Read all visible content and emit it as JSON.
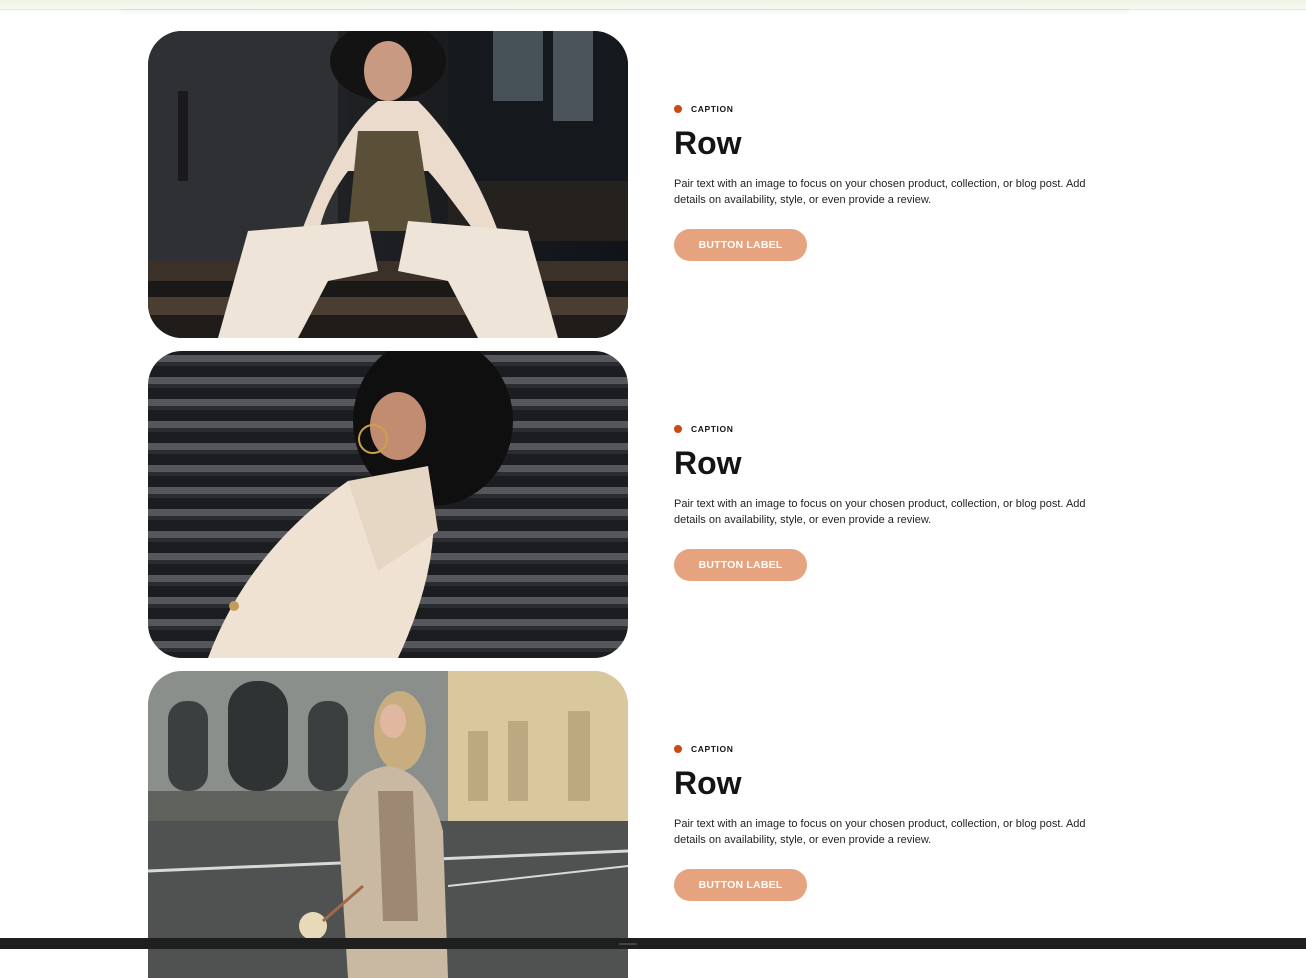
{
  "theme": {
    "accent": "#c94a12",
    "button_bg": "#e5a37f",
    "text": "#141414"
  },
  "rows": [
    {
      "caption": "CAPTION",
      "heading": "Row",
      "body": "Pair text with an image to focus on your chosen product, collection, or blog post. Add details on availability, style, or even provide a review.",
      "button_label": "BUTTON LABEL",
      "image_alt": "woman-in-cream-suit-sitting-on-steps"
    },
    {
      "caption": "CAPTION",
      "heading": "Row",
      "body": "Pair text with an image to focus on your chosen product, collection, or blog post. Add details on availability, style, or even provide a review.",
      "button_label": "BUTTON LABEL",
      "image_alt": "woman-in-cream-blazer-against-shutter"
    },
    {
      "caption": "CAPTION",
      "heading": "Row",
      "body": "Pair text with an image to focus on your chosen product, collection, or blog post. Add details on availability, style, or even provide a review.",
      "button_label": "BUTTON LABEL",
      "image_alt": "woman-walking-on-city-street"
    }
  ]
}
